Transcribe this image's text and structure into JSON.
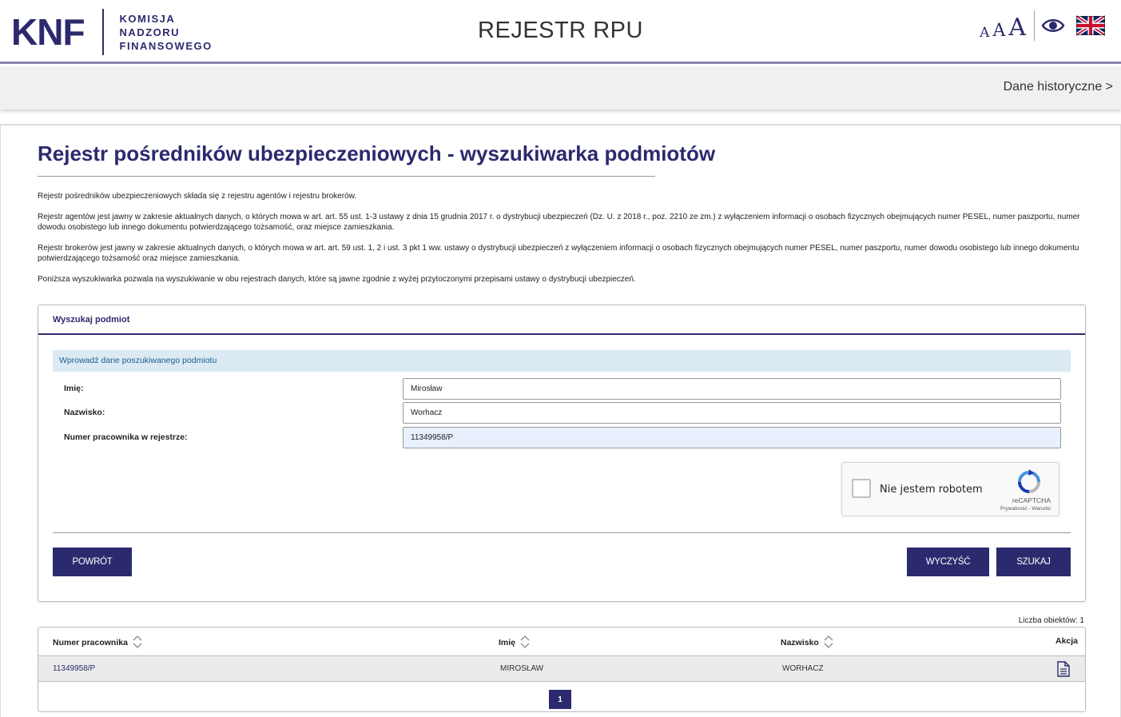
{
  "header": {
    "logo_main": "KNF",
    "logo_line1": "KOMISJA",
    "logo_line2": "NADZORU",
    "logo_line3": "FINANSOWEGO",
    "app_title": "REJESTR RPU",
    "font_small": "A",
    "font_medium": "A",
    "font_large": "A",
    "contrast_icon": "eye-icon",
    "language_icon": "uk-flag-icon"
  },
  "subbar": {
    "historic_link": "Dane historyczne >"
  },
  "page": {
    "title": "Rejestr pośredników ubezpieczeniowych - wyszukiwarka podmiotów",
    "intro": [
      "Rejestr pośredników ubezpieczeniowych składa się z rejestru agentów i rejestru brokerów.",
      "Rejestr agentów jest jawny w zakresie aktualnych danych, o których mowa w art. art. 55 ust. 1-3 ustawy z dnia 15 grudnia 2017 r. o dystrybucji ubezpieczeń (Dz. U. z 2018 r., poz. 2210 ze zm.) z wyłączeniem informacji o osobach fizycznych obejmujących numer PESEL, numer paszportu, numer dowodu osobistego lub innego dokumentu potwierdzającego tożsamość, oraz miejsce zamieszkania.",
      "Rejestr brokerów jest jawny w zakresie aktualnych danych, o których mowa w art. art. 59 ust. 1, 2 i ust. 3 pkt 1 ww. ustawy o dystrybucji ubezpieczeń z wyłączeniem informacji o osobach fizycznych obejmujących numer PESEL, numer paszportu, numer dowodu osobistego lub innego dokumentu potwierdzającego tożsamość oraz miejsce zamieszkania.",
      "Poniższa wyszukiwarka pozwala na wyszukiwanie w obu rejestrach danych, które są jawne zgodnie z wyżej przytoczonymi przepisami ustawy o dystrybucji ubezpieczeń."
    ]
  },
  "search": {
    "panel_title": "Wyszukaj podmiot",
    "info": "Wprowadź dane poszukiwanego podmiotu",
    "first_name_label": "Imię:",
    "first_name_value": "Mirosław",
    "last_name_label": "Nazwisko:",
    "last_name_value": "Worhacz",
    "employee_no_label": "Numer pracownika w rejestrze:",
    "employee_no_value": "11349958/P",
    "captcha_label": "Nie jestem robotem",
    "captcha_brand": "reCAPTCHA",
    "captcha_links": "Prywatność - Warunki",
    "back_button": "POWRÓT",
    "clear_button": "WYCZYŚĆ",
    "search_button": "SZUKAJ"
  },
  "results": {
    "count_text": "Liczba obiektów: 1",
    "columns": [
      "Numer pracownika",
      "Imię",
      "Nazwisko",
      "Akcja"
    ],
    "rows": [
      {
        "employee_no": "11349958/P",
        "first_name": "MIROSŁAW",
        "last_name": "WORHACZ",
        "action_icon": "document-icon"
      }
    ],
    "pages": [
      "1"
    ]
  },
  "colors": {
    "brand": "#2b2a6e",
    "info_bg": "#dbeaf3",
    "info_text": "#1c5c8a",
    "row_bg": "#ebebeb"
  }
}
